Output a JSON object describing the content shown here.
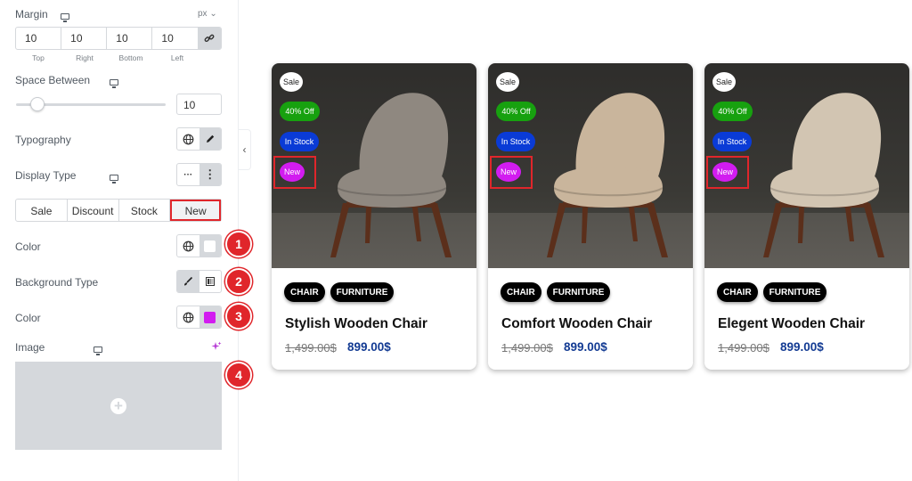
{
  "panel": {
    "margin": {
      "label": "Margin",
      "unit": "px ⌄",
      "values": [
        "10",
        "10",
        "10",
        "10"
      ],
      "sides": [
        "Top",
        "Right",
        "Bottom",
        "Left"
      ]
    },
    "space_between": {
      "label": "Space Between",
      "value": "10",
      "level_fraction": 0.1
    },
    "typography": {
      "label": "Typography"
    },
    "display_type": {
      "label": "Display Type",
      "more": "···",
      "dots": "⋮"
    },
    "tabs": [
      "Sale",
      "Discount",
      "Stock",
      "New"
    ],
    "color1": {
      "label": "Color",
      "swatch": "#ffffff"
    },
    "background_type": {
      "label": "Background Type"
    },
    "color2": {
      "label": "Color",
      "swatch": "#d21cf0"
    },
    "image": {
      "label": "Image"
    },
    "callouts": [
      "1",
      "2",
      "3",
      "4"
    ],
    "collapse_icon": "‹"
  },
  "cards": [
    {
      "tags": {
        "sale": "Sale",
        "discount": "40% Off",
        "stock": "In Stock",
        "new": "New"
      },
      "chips": [
        "CHAIR",
        "FURNITURE"
      ],
      "title": "Stylish Wooden Chair",
      "old_price": "1,499.00$",
      "price": "899.00$",
      "chair_color": "#8f8880"
    },
    {
      "tags": {
        "sale": "Sale",
        "discount": "40% Off",
        "stock": "In Stock",
        "new": "New"
      },
      "chips": [
        "CHAIR",
        "FURNITURE"
      ],
      "title": "Comfort Wooden Chair",
      "old_price": "1,499.00$",
      "price": "899.00$",
      "chair_color": "#c9b59c"
    },
    {
      "tags": {
        "sale": "Sale",
        "discount": "40% Off",
        "stock": "In Stock",
        "new": "New"
      },
      "chips": [
        "CHAIR",
        "FURNITURE"
      ],
      "title": "Elegent Wooden Chair",
      "old_price": "1,499.00$",
      "price": "899.00$",
      "chair_color": "#d2c5b2"
    }
  ],
  "colors": {
    "sale_bg": "#ffffff",
    "discount_bg": "#17a10f",
    "stock_bg": "#0a3bd6",
    "new_bg": "#d21cf0",
    "highlight": "#e0262b",
    "price": "#133b93"
  }
}
